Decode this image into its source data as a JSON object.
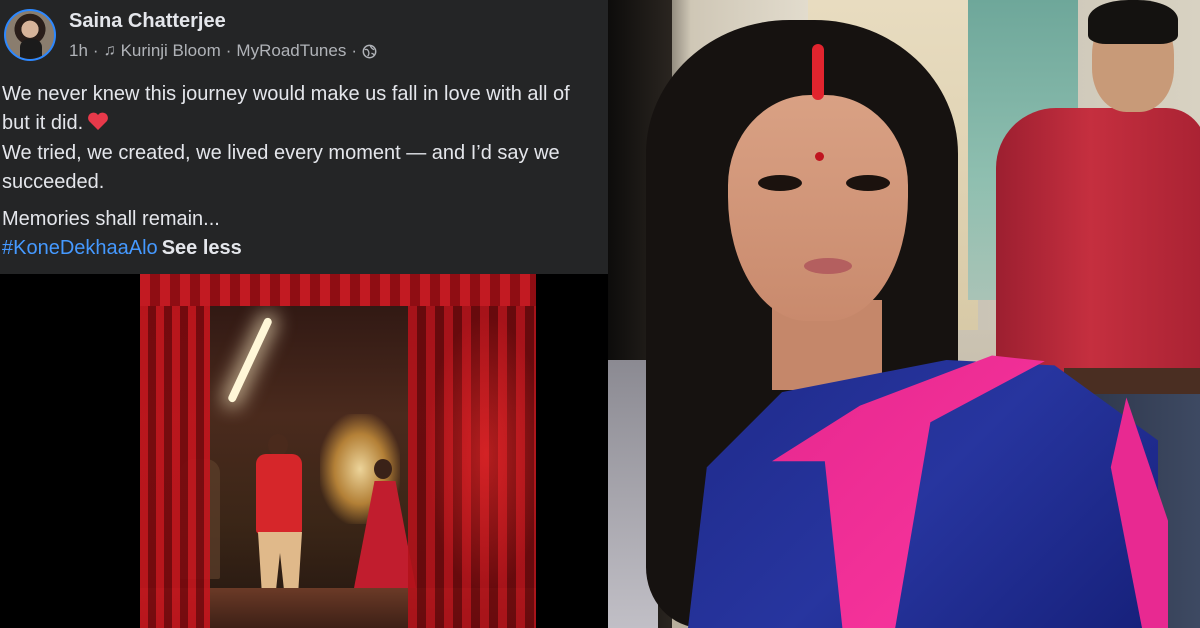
{
  "post": {
    "author": "Saina Chatterjee",
    "time": "1h",
    "separator": "·",
    "music_title": "Kurinji Bloom",
    "music_artist": "MyRoadTunes",
    "lines": [
      "We never knew this journey would make us fall in love with all of",
      "but it did.",
      "We tried, we created, we lived every moment — and I’d say we",
      "succeeded."
    ],
    "memories": "Memories shall remain...",
    "hashtag": "#KoneDekhaaAlo",
    "see_less": "See less"
  },
  "colors": {
    "panel_bg": "#242526",
    "text_primary": "#e4e6eb",
    "text_secondary": "#b0b3b8",
    "link": "#4599ff",
    "avatar_ring": "#2d88ff",
    "heart": "#e8394a"
  },
  "icons": {
    "music": "music-note-icon",
    "privacy": "globe-icon",
    "emoji": "heart-icon"
  }
}
